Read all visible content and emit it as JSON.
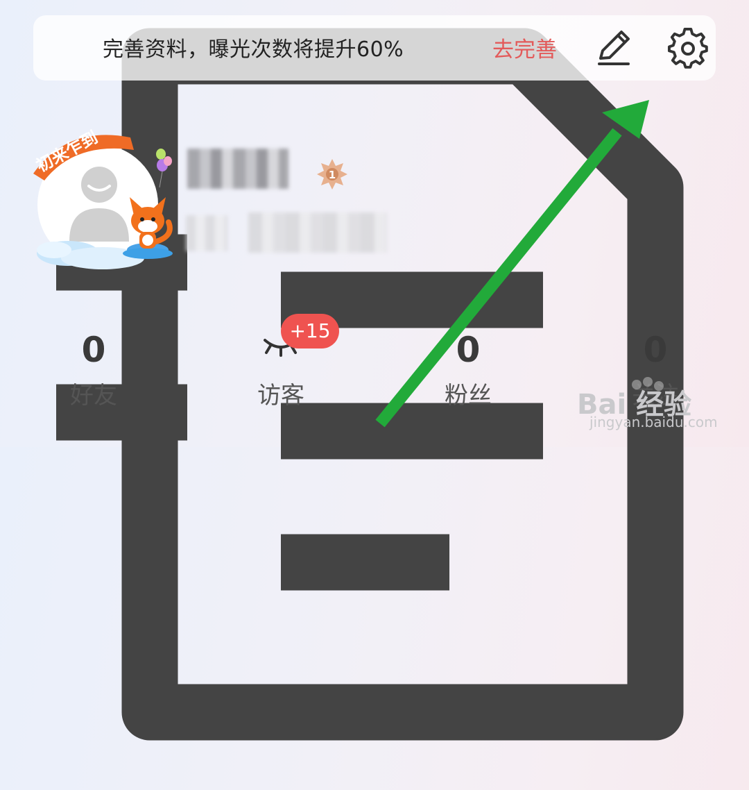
{
  "banner": {
    "text": "完善资料，曝光次数将提升60%",
    "action": "去完善",
    "icon": "document-icon"
  },
  "toolbar": {
    "edit_icon": "edit-pencil-icon",
    "settings_icon": "gear-icon"
  },
  "profile": {
    "avatar_badge_text": "初来乍到",
    "level": "1"
  },
  "stats": [
    {
      "value": "0",
      "label": "好友"
    },
    {
      "value": "",
      "label": "访客",
      "badge": "+15"
    },
    {
      "value": "0",
      "label": "粉丝"
    },
    {
      "value": "0",
      "label": "关注"
    }
  ],
  "watermark": {
    "text": "Bai 经验",
    "sub": "jingyan.baidu.com"
  },
  "colors": {
    "accent_red": "#e35a5a",
    "badge_red": "#ef5350",
    "arrow_green": "#22aa3a"
  }
}
